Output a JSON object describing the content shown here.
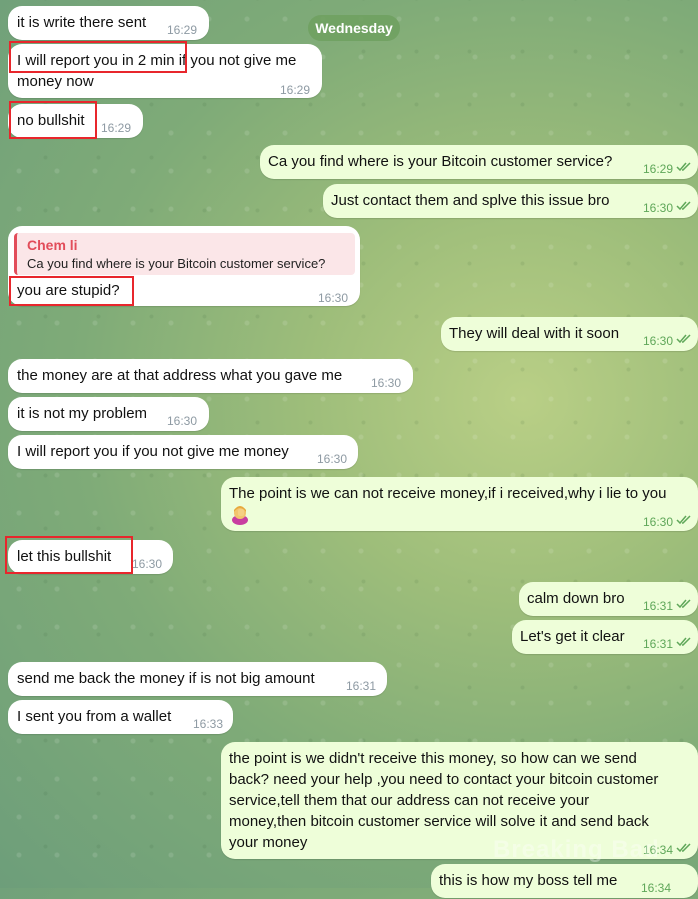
{
  "day_separator": "Wednesday",
  "reply_quote": {
    "author": "Chem li",
    "text": "Ca you find where is your Bitcoin customer service?"
  },
  "watermark": "Breaking Bad",
  "colors": {
    "incoming_bubble": "#ffffff",
    "outgoing_bubble": "#eefed9",
    "highlight_box": "#e8262c",
    "reply_accent": "#e24d5a",
    "time_outgoing": "#5fa759"
  },
  "messages": [
    {
      "dir": "in",
      "lines": [
        "it is write there sent"
      ],
      "time": "16:29"
    },
    {
      "dir": "in",
      "lines": [
        "I will report you in 2 min if you not give me",
        "money now"
      ],
      "time": "16:29"
    },
    {
      "dir": "in",
      "lines": [
        "no bullshit"
      ],
      "time": "16:29"
    },
    {
      "dir": "out",
      "lines": [
        "Ca you find where is your Bitcoin customer service?"
      ],
      "time": "16:29"
    },
    {
      "dir": "out",
      "lines": [
        "Just contact them and splve this issue bro"
      ],
      "time": "16:30"
    },
    {
      "dir": "in",
      "lines": [
        "you are stupid?"
      ],
      "time": "16:30"
    },
    {
      "dir": "out",
      "lines": [
        "They will deal with it soon"
      ],
      "time": "16:30"
    },
    {
      "dir": "in",
      "lines": [
        "the money are at that address what you gave me"
      ],
      "time": "16:30"
    },
    {
      "dir": "in",
      "lines": [
        "it is not my problem"
      ],
      "time": "16:30"
    },
    {
      "dir": "in",
      "lines": [
        "I will report you if you not give me money"
      ],
      "time": "16:30"
    },
    {
      "dir": "out",
      "lines": [
        "The point is we can not receive money,if i received,why i lie to you"
      ],
      "emoji": "person-facepalming",
      "time": "16:30"
    },
    {
      "dir": "in",
      "lines": [
        "let this bullshit"
      ],
      "time": "16:30"
    },
    {
      "dir": "out",
      "lines": [
        "calm down bro"
      ],
      "time": "16:31"
    },
    {
      "dir": "out",
      "lines": [
        "Let's get it clear"
      ],
      "time": "16:31"
    },
    {
      "dir": "in",
      "lines": [
        "send me back the money if is not big amount"
      ],
      "time": "16:31"
    },
    {
      "dir": "in",
      "lines": [
        "I sent you from a wallet"
      ],
      "time": "16:33"
    },
    {
      "dir": "out",
      "lines": [
        "the point is we didn't receive this money, so how can we send",
        "back? need your help ,you need to contact your bitcoin customer",
        "service,tell them that our address can not receive your",
        "money,then bitcoin customer service will solve it and send back",
        "your money"
      ],
      "time": "16:34"
    },
    {
      "dir": "out",
      "lines": [
        "this is how my boss tell me"
      ],
      "time": "16:34"
    }
  ]
}
